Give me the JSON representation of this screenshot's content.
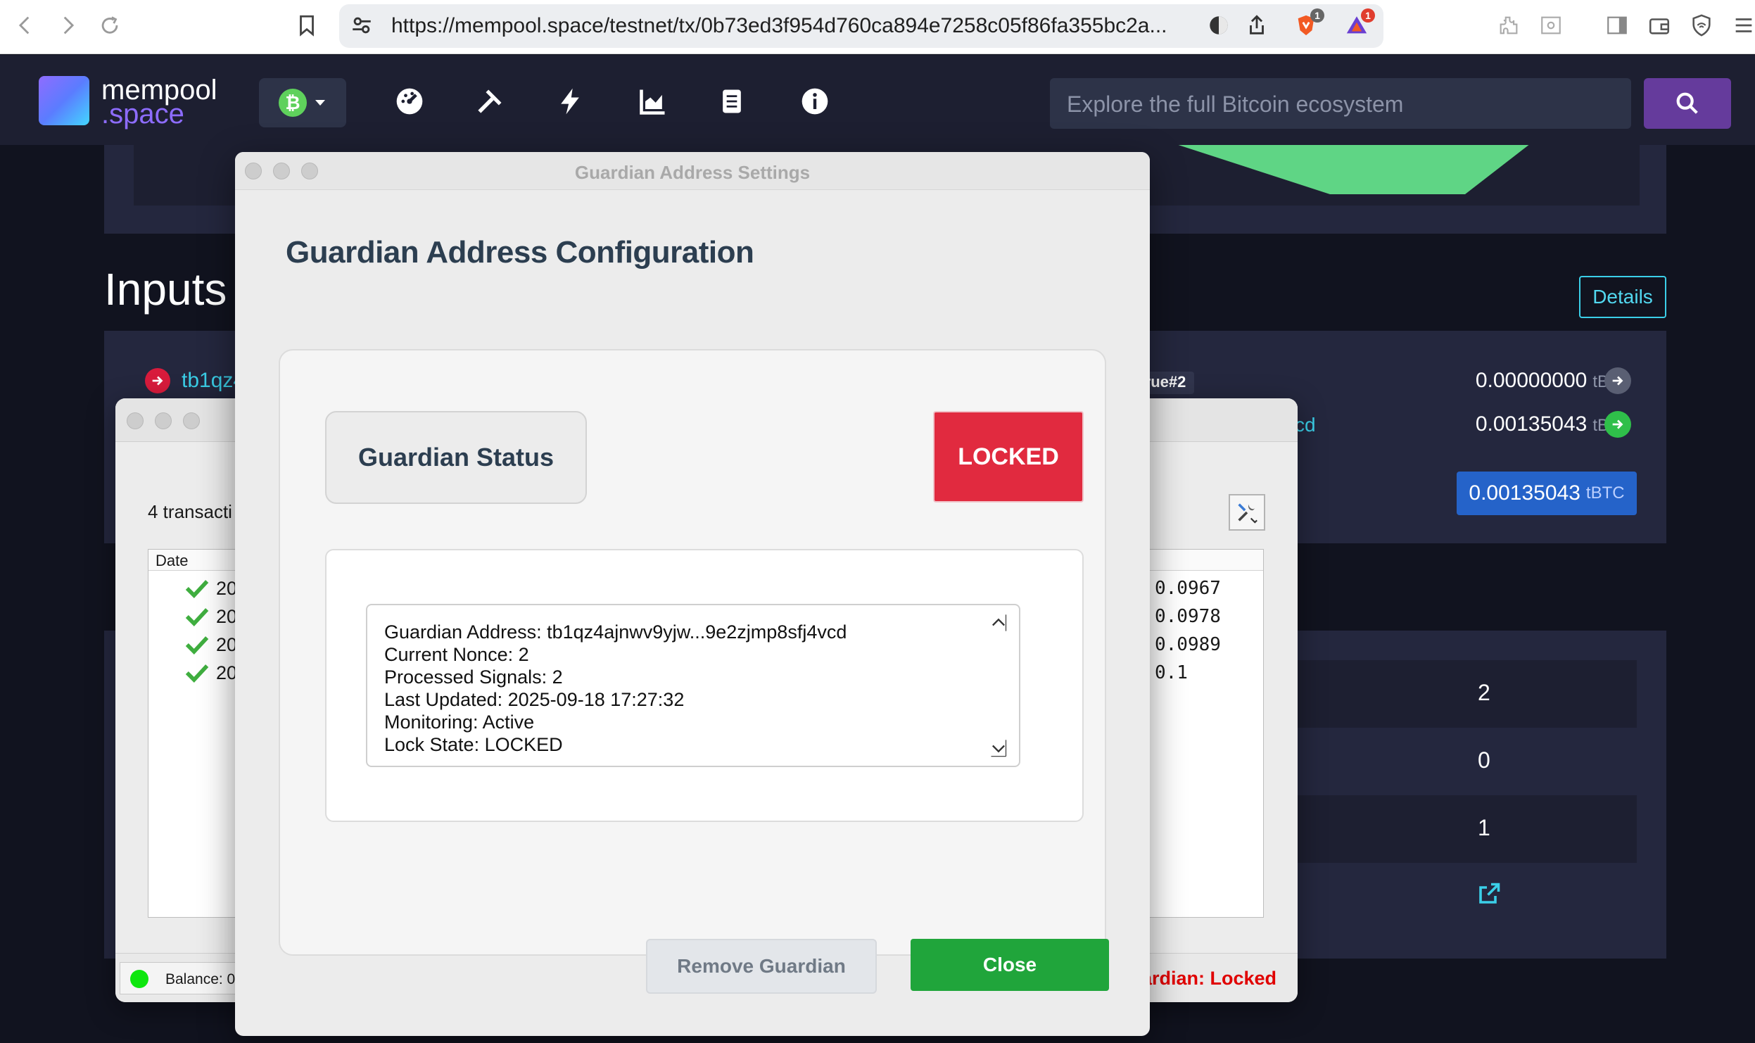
{
  "browser": {
    "url": "https://mempool.space/testnet/tx/0b73ed3f954d760ca894e7258c05f86fa355bc2a...",
    "brave_badge": "1",
    "rewards_badge": "1"
  },
  "site": {
    "logo_line1": "mempool",
    "logo_line2": ".space",
    "network_symbol": "₿",
    "search_placeholder": "Explore the full Bitcoin ecosystem"
  },
  "page": {
    "inputs_heading": "Inputs",
    "details_label": "Details",
    "input_address": "tb1qz4",
    "script_badge": ":true#2",
    "output_address_tail": "cd",
    "amounts": [
      {
        "value": "0.00000000",
        "unit": "tBTC"
      },
      {
        "value": "0.00135043",
        "unit": "tBTC"
      }
    ],
    "total": {
      "value": "0.00135043",
      "unit": "tBTC"
    },
    "stats": [
      "2",
      "0",
      "1"
    ]
  },
  "wallet": {
    "tx_count": "4 transacti",
    "date_header": "Date",
    "rows": [
      {
        "date": "20",
        "amount": "0.0967"
      },
      {
        "date": "20",
        "amount": "0.0978"
      },
      {
        "date": "20",
        "amount": "0.0989"
      },
      {
        "date": "20",
        "amount": "0.1"
      }
    ],
    "balance": "Balance: 0.",
    "guardian_status": "ardian: Locked"
  },
  "dialog": {
    "window_title": "Guardian Address Settings",
    "heading": "Guardian Address Configuration",
    "status_label": "Guardian Status",
    "lock_state": "LOCKED",
    "info_lines": [
      "Guardian Address: tb1qz4ajnwv9yjw...9e2zjmp8sfj4vcd",
      "Current Nonce: 2",
      "Processed Signals: 2",
      "Last Updated: 2025-09-18 17:27:32",
      "Monitoring: Active",
      "Lock State: LOCKED"
    ],
    "remove_label": "Remove Guardian",
    "close_label": "Close"
  },
  "colors": {
    "locked_red": "#e12a3f",
    "close_green": "#20a53b",
    "header_bg": "#1d1f31",
    "accent_cyan": "#3bcfe8"
  }
}
